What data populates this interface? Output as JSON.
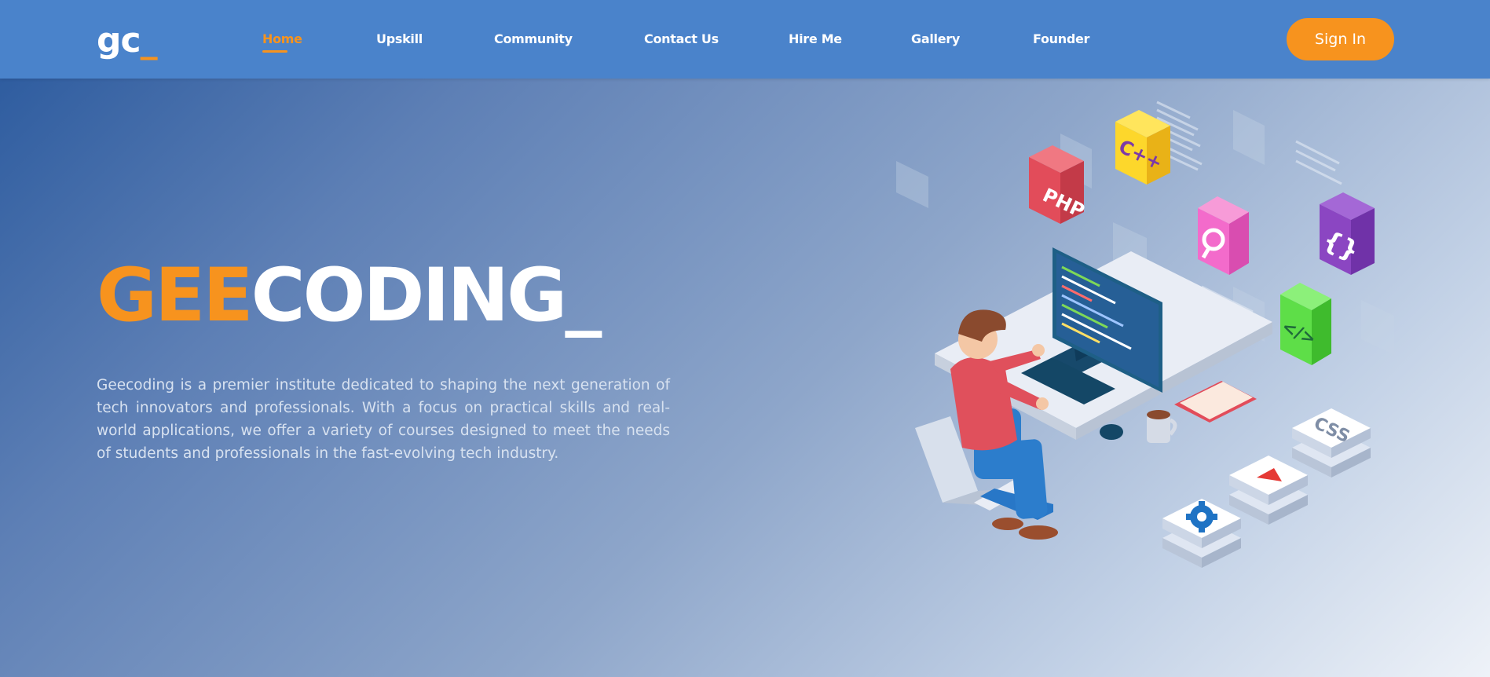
{
  "brand": {
    "logo_text": "gc",
    "logo_cursor": "_"
  },
  "nav": {
    "items": [
      {
        "label": "Home",
        "active": true
      },
      {
        "label": "Upskill"
      },
      {
        "label": "Community"
      },
      {
        "label": "Contact Us"
      },
      {
        "label": "Hire Me"
      },
      {
        "label": "Gallery"
      },
      {
        "label": "Founder"
      }
    ],
    "signin_label": "Sign In"
  },
  "hero": {
    "title_accent": "GEE",
    "title_rest": "CODING_",
    "description": "Geecoding is a premier institute dedicated to shaping the next generation of tech innovators and professionals. With a focus on practical skills and real-world applications, we offer a variety of courses designed to meet the needs of students and professionals in the fast-evolving tech industry."
  },
  "illustration": {
    "php_label": "PHP",
    "cpp_label": "C++",
    "braces_label": "{}",
    "tag_label": "</>",
    "css_label": "CSS"
  },
  "colors": {
    "header_bg": "#4a83cb",
    "accent": "#f7931e",
    "text_light": "#d8e2f0"
  }
}
